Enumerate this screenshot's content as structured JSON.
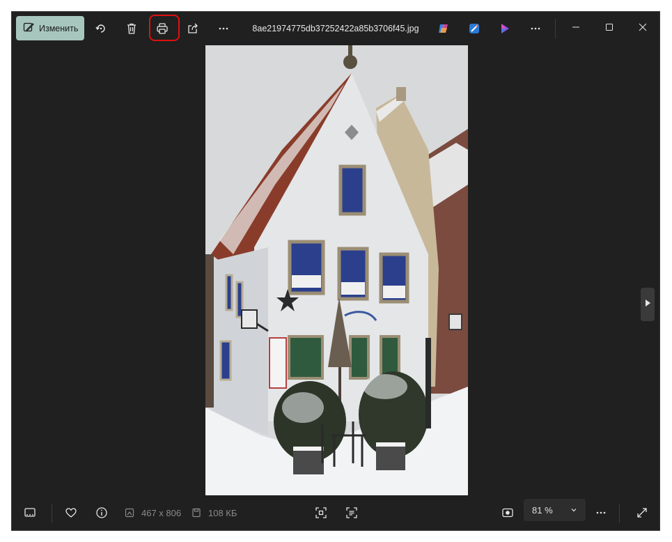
{
  "toolbar": {
    "edit_label": "Изменить",
    "filename": "8ae21974775db37252422a85b3706f45.jpg",
    "icons": [
      "edit-icon",
      "rotate-icon",
      "delete-icon",
      "print-icon",
      "share-icon",
      "more-icon",
      "copilot-icon",
      "designer-icon",
      "clipchamp-icon",
      "more-icon"
    ]
  },
  "window_controls": [
    "minimize",
    "maximize",
    "close"
  ],
  "statusbar": {
    "dimensions": "467 x 806",
    "file_size": "108 КБ",
    "zoom_value": "81 %"
  },
  "colors": {
    "accent": "#a7c7be",
    "highlight": "#e01010",
    "background": "#202020"
  }
}
